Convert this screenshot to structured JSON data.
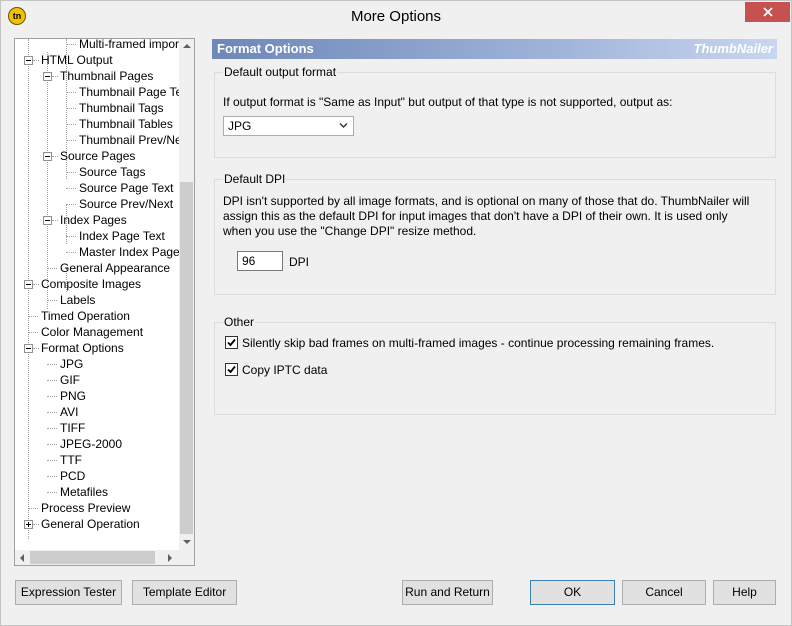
{
  "window": {
    "title": "More Options",
    "app_icon": "tn"
  },
  "tree": {
    "items": [
      {
        "label": "Multi-framed import plug-in",
        "level": 2,
        "expander": "none"
      },
      {
        "label": "HTML Output",
        "level": 0,
        "expander": "minus"
      },
      {
        "label": "Thumbnail Pages",
        "level": 1,
        "expander": "minus"
      },
      {
        "label": "Thumbnail Page Text",
        "level": 2,
        "expander": "none"
      },
      {
        "label": "Thumbnail Tags",
        "level": 2,
        "expander": "none"
      },
      {
        "label": "Thumbnail Tables",
        "level": 2,
        "expander": "none"
      },
      {
        "label": "Thumbnail Prev/Next",
        "level": 2,
        "expander": "none"
      },
      {
        "label": "Source Pages",
        "level": 1,
        "expander": "minus"
      },
      {
        "label": "Source Tags",
        "level": 2,
        "expander": "none"
      },
      {
        "label": "Source Page Text",
        "level": 2,
        "expander": "none"
      },
      {
        "label": "Source Prev/Next",
        "level": 2,
        "expander": "none"
      },
      {
        "label": "Index Pages",
        "level": 1,
        "expander": "minus"
      },
      {
        "label": "Index Page Text",
        "level": 2,
        "expander": "none"
      },
      {
        "label": "Master Index Page",
        "level": 2,
        "expander": "none"
      },
      {
        "label": "General Appearance",
        "level": 1,
        "expander": "none"
      },
      {
        "label": "Composite Images",
        "level": 0,
        "expander": "minus"
      },
      {
        "label": "Labels",
        "level": 1,
        "expander": "none"
      },
      {
        "label": "Timed Operation",
        "level": 0,
        "expander": "none"
      },
      {
        "label": "Color Management",
        "level": 0,
        "expander": "none"
      },
      {
        "label": "Format Options",
        "level": 0,
        "expander": "minus"
      },
      {
        "label": "JPG",
        "level": 1,
        "expander": "none"
      },
      {
        "label": "GIF",
        "level": 1,
        "expander": "none"
      },
      {
        "label": "PNG",
        "level": 1,
        "expander": "none"
      },
      {
        "label": "AVI",
        "level": 1,
        "expander": "none"
      },
      {
        "label": "TIFF",
        "level": 1,
        "expander": "none"
      },
      {
        "label": "JPEG-2000",
        "level": 1,
        "expander": "none"
      },
      {
        "label": "TTF",
        "level": 1,
        "expander": "none"
      },
      {
        "label": "PCD",
        "level": 1,
        "expander": "none"
      },
      {
        "label": "Metafiles",
        "level": 1,
        "expander": "none"
      },
      {
        "label": "Process Preview",
        "level": 0,
        "expander": "none"
      },
      {
        "label": "General Operation",
        "level": 0,
        "expander": "plus"
      }
    ]
  },
  "header": {
    "title": "Format Options",
    "brand": "ThumbNailer"
  },
  "default_output": {
    "title": "Default output format",
    "description": "If output format is \"Same as Input\" but output of that type is not supported, output as:",
    "selected": "JPG"
  },
  "default_dpi": {
    "title": "Default DPI",
    "line1": "DPI isn't supported by all image formats, and is optional on many of those that do. ThumbNailer will",
    "line2": "assign this as the default DPI for input images that don't have a DPI of their own. It is used only",
    "line3": "when you use the \"Change DPI\" resize method.",
    "value": "96",
    "unit": "DPI"
  },
  "other": {
    "title": "Other",
    "skip_bad_frames": {
      "label": "Silently skip bad frames on multi-framed images - continue processing remaining frames.",
      "checked": true
    },
    "copy_iptc": {
      "label": "Copy IPTC data",
      "checked": true
    }
  },
  "buttons": {
    "expression_tester": "Expression Tester",
    "template_editor": "Template Editor",
    "run_and_return": "Run and Return",
    "ok": "OK",
    "cancel": "Cancel",
    "help": "Help"
  },
  "colors": {
    "close": "#c75050",
    "header_start": "#6d87b8",
    "default_button_border": "#3c7fb1"
  }
}
